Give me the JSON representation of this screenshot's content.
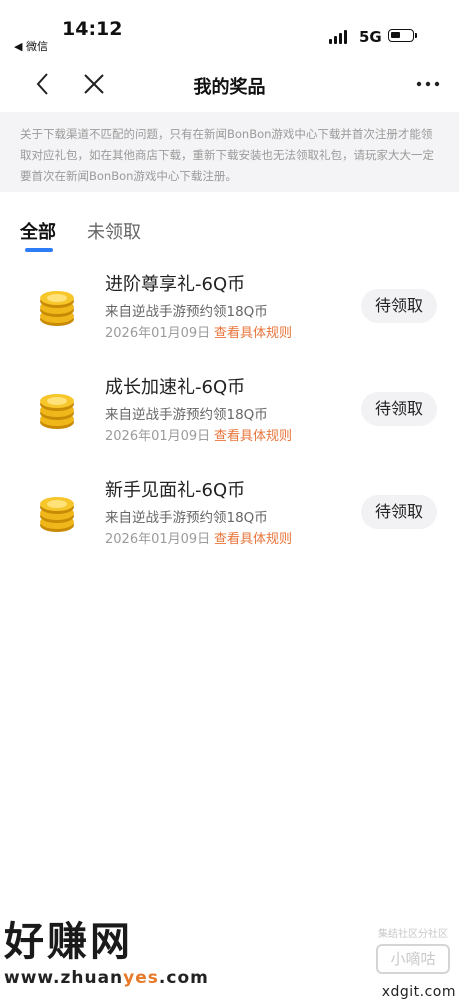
{
  "status_bar": {
    "time": "14:12",
    "back_app": "◀ 微信",
    "network": "5G"
  },
  "nav": {
    "title": "我的奖品"
  },
  "notice": {
    "text": "关于下载渠道不匹配的问题，只有在新闻BonBon游戏中心下载并首次注册才能领取对应礼包，如在其他商店下载，重新下载安装也无法领取礼包，请玩家大大一定要首次在新闻BonBon游戏中心下载注册。"
  },
  "tabs": [
    {
      "label": "全部",
      "active": true
    },
    {
      "label": "未领取",
      "active": false
    }
  ],
  "prizes": [
    {
      "title": "进阶尊享礼-6Q币",
      "source": "来自逆战手游预约领18Q币",
      "date": "2026年01月09日",
      "rule_link": "查看具体规则",
      "action": "待领取",
      "icon": "gold-coin-icon"
    },
    {
      "title": "成长加速礼-6Q币",
      "source": "来自逆战手游预约领18Q币",
      "date": "2026年01月09日",
      "rule_link": "查看具体规则",
      "action": "待领取",
      "icon": "gold-coin-icon"
    },
    {
      "title": "新手见面礼-6Q币",
      "source": "来自逆战手游预约领18Q币",
      "date": "2026年01月09日",
      "rule_link": "查看具体规则",
      "action": "待领取",
      "icon": "gold-coin-icon"
    }
  ],
  "watermarks": {
    "left_big": "好赚网",
    "left_url_a": "www.zhuan",
    "left_url_b": "yes",
    "left_url_c": ".com",
    "right_sub": "集结社区分社区",
    "right_box": "小嘀咕",
    "right_site": "xdgit.com"
  },
  "colors": {
    "accent_blue": "#2e7cf6",
    "link_orange": "#e8743a",
    "notice_bg": "#f4f4f6",
    "button_bg": "#f2f2f4"
  }
}
